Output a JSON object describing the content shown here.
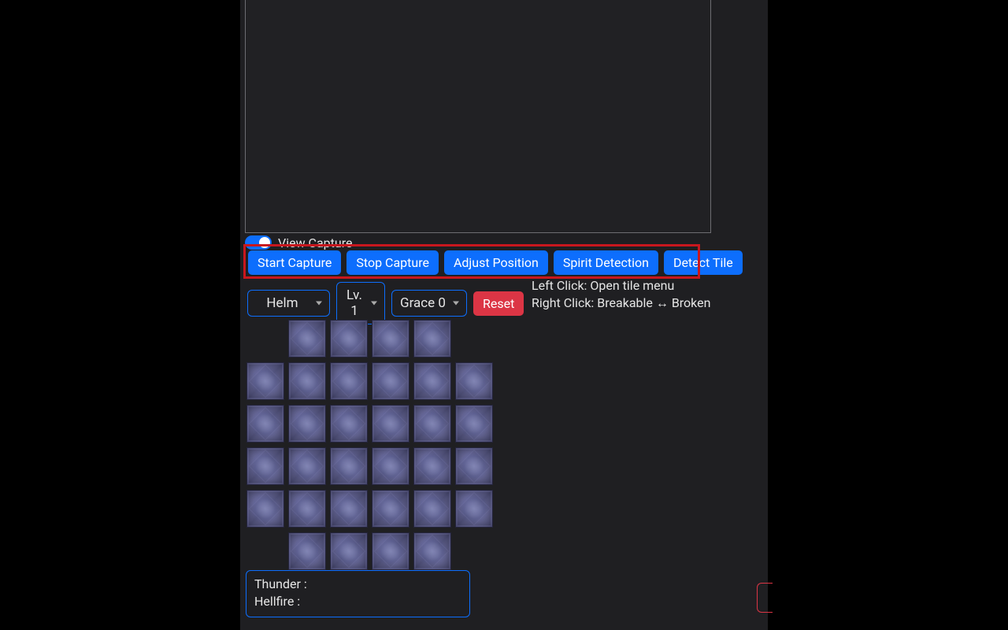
{
  "toggle": {
    "view_capture_label": "View Capture",
    "on": true
  },
  "buttons": {
    "start_capture": "Start Capture",
    "stop_capture": "Stop Capture",
    "adjust_position": "Adjust Position",
    "spirit_detection": "Spirit Detection",
    "detect_tile": "Detect Tile",
    "reset": "Reset"
  },
  "selects": {
    "slot": "Helm",
    "level": "Lv. 1",
    "grace": "Grace 0"
  },
  "help": {
    "left": "Left Click: Open tile menu",
    "right": "Right Click: Breakable ↔ Broken"
  },
  "board": {
    "rows": [
      4,
      6,
      6,
      6,
      6,
      4
    ],
    "offsets": [
      1,
      0,
      0,
      0,
      0,
      1
    ]
  },
  "status": {
    "thunder_label": "Thunder :",
    "hellfire_label": "Hellfire :"
  },
  "colors": {
    "primary": "#0d6efd",
    "danger": "#dc3545",
    "highlight": "#c8171e"
  }
}
